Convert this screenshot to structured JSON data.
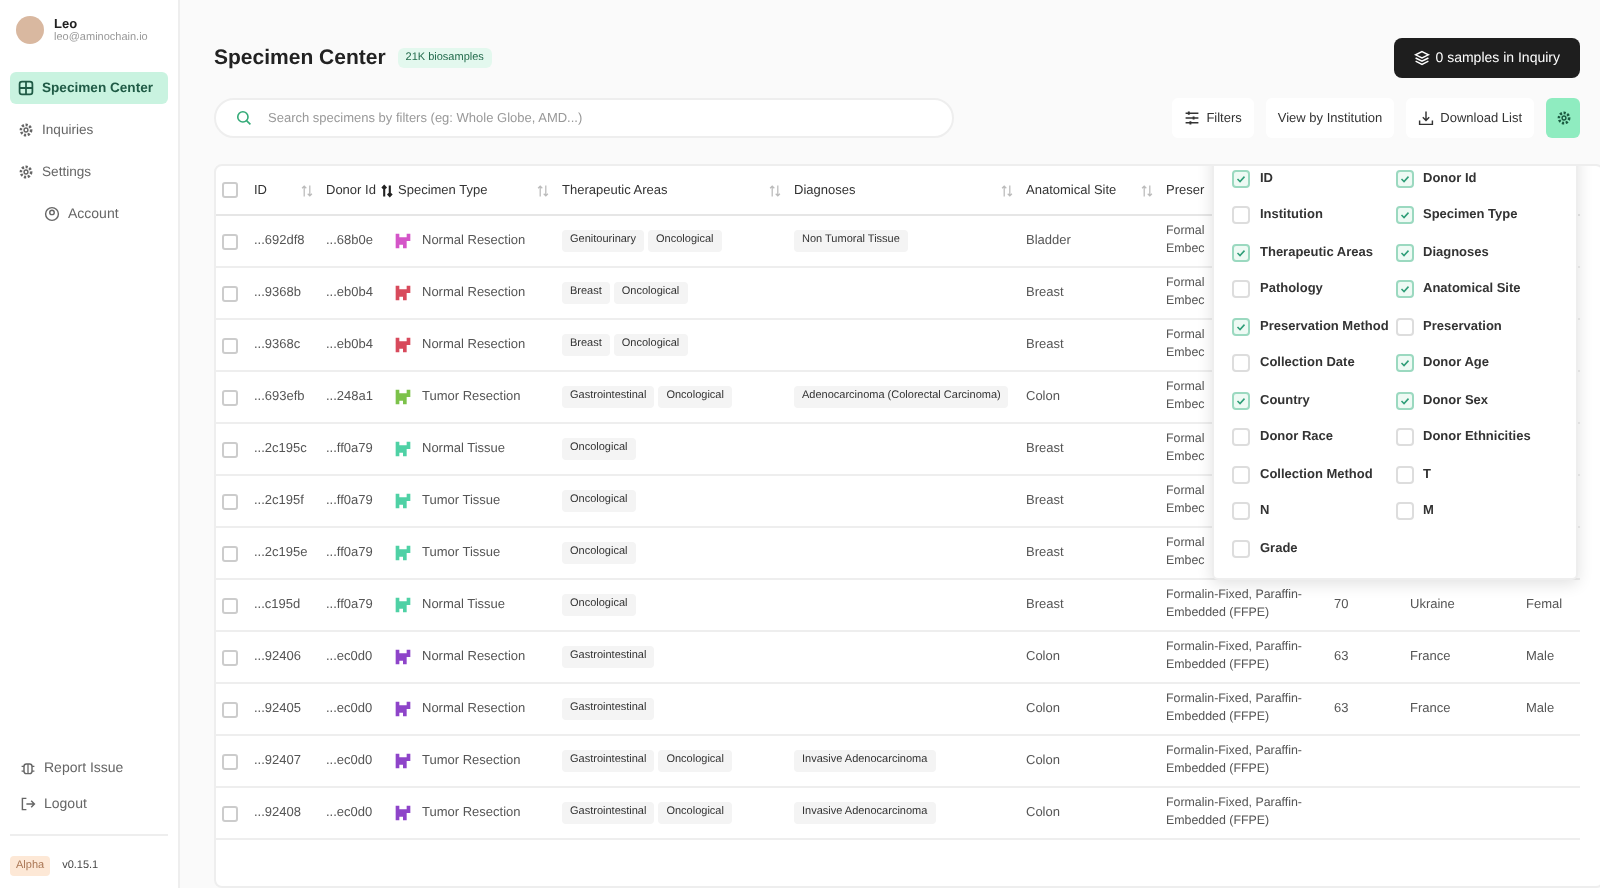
{
  "user": {
    "name": "Leo",
    "email": "leo@aminochain.io"
  },
  "nav": [
    {
      "label": "Specimen Center",
      "selected": true
    },
    {
      "label": "Inquiries",
      "selected": false
    },
    {
      "label": "Settings",
      "selected": false
    }
  ],
  "sub_nav": {
    "label": "Account"
  },
  "footer_nav": [
    {
      "label": "Report Issue"
    },
    {
      "label": "Logout"
    }
  ],
  "release": {
    "badge": "Alpha",
    "version": "v0.15.1"
  },
  "header": {
    "title": "Specimen Center",
    "count_badge": "21K biosamples",
    "inquiry_button": "0 samples in Inquiry"
  },
  "search": {
    "placeholder": "Search specimens by filters (eg: Whole Globe, AMD...)"
  },
  "toolbar": [
    {
      "label": "Filters"
    },
    {
      "label": "View by Institution"
    },
    {
      "label": "Download List"
    }
  ],
  "settings_button": {
    "active": true
  },
  "table": {
    "all_checked": false,
    "columns": [
      {
        "label": "ID",
        "sorted": false
      },
      {
        "label": "Donor Id",
        "sorted": true
      },
      {
        "label": "Specimen Type",
        "sorted": false
      },
      {
        "label": "Therapeutic Areas",
        "sorted": false
      },
      {
        "label": "Diagnoses",
        "sorted": false
      },
      {
        "label": "Anatomical Site",
        "sorted": false
      },
      {
        "label": "Preser"
      }
    ],
    "rows": [
      {
        "checked": false,
        "id": "...692df8",
        "donor": "...68b0e",
        "color": "#d455c8",
        "type": "Normal Resection",
        "areas": [
          "Genitourinary",
          "Oncological"
        ],
        "diagnoses": [
          "Non Tumoral Tissue"
        ],
        "site": "Bladder",
        "preservation": "Formal\nEmbec"
      },
      {
        "checked": false,
        "id": "...9368b",
        "donor": "...eb0b4",
        "color": "#d84a5c",
        "type": "Normal Resection",
        "areas": [
          "Breast",
          "Oncological"
        ],
        "diagnoses": [],
        "site": "Breast",
        "preservation": "Formal\nEmbec"
      },
      {
        "checked": false,
        "id": "...9368c",
        "donor": "...eb0b4",
        "color": "#d84a5c",
        "type": "Normal Resection",
        "areas": [
          "Breast",
          "Oncological"
        ],
        "diagnoses": [],
        "site": "Breast",
        "preservation": "Formal\nEmbec"
      },
      {
        "checked": false,
        "id": "...693efb",
        "donor": "...248a1",
        "color": "#7cc24a",
        "type": "Tumor Resection",
        "areas": [
          "Gastrointestinal",
          "Oncological"
        ],
        "diagnoses": [
          "Adenocarcinoma (Colorectal Carcinoma)"
        ],
        "site": "Colon",
        "preservation": "Formal\nEmbec"
      },
      {
        "checked": false,
        "id": "...2c195c",
        "donor": "...ff0a79",
        "color": "#4fd1a5",
        "type": "Normal Tissue",
        "areas": [
          "Oncological"
        ],
        "diagnoses": [],
        "site": "Breast",
        "preservation": "Formal\nEmbec"
      },
      {
        "checked": false,
        "id": "...2c195f",
        "donor": "...ff0a79",
        "color": "#4fd1a5",
        "type": "Tumor Tissue",
        "areas": [
          "Oncological"
        ],
        "diagnoses": [],
        "site": "Breast",
        "preservation": "Formal\nEmbec"
      },
      {
        "checked": false,
        "id": "...2c195e",
        "donor": "...ff0a79",
        "color": "#4fd1a5",
        "type": "Tumor Tissue",
        "areas": [
          "Oncological"
        ],
        "diagnoses": [],
        "site": "Breast",
        "preservation": "Formal\nEmbec"
      },
      {
        "checked": false,
        "id": "...c195d",
        "donor": "...ff0a79",
        "color": "#4fd1a5",
        "type": "Normal Tissue",
        "areas": [
          "Oncological"
        ],
        "diagnoses": [],
        "site": "Breast",
        "preservation": "Formalin-Fixed, Paraffin-\nEmbedded (FFPE)",
        "age": "70",
        "country": "Ukraine",
        "sex": "Femal"
      },
      {
        "checked": false,
        "id": "...92406",
        "donor": "...ec0d0",
        "color": "#8e44c9",
        "type": "Normal Resection",
        "areas": [
          "Gastrointestinal"
        ],
        "diagnoses": [],
        "site": "Colon",
        "preservation": "Formalin-Fixed, Paraffin-\nEmbedded (FFPE)",
        "age": "63",
        "country": "France",
        "sex": "Male"
      },
      {
        "checked": false,
        "id": "...92405",
        "donor": "...ec0d0",
        "color": "#8e44c9",
        "type": "Normal Resection",
        "areas": [
          "Gastrointestinal"
        ],
        "diagnoses": [],
        "site": "Colon",
        "preservation": "Formalin-Fixed, Paraffin-\nEmbedded (FFPE)",
        "age": "63",
        "country": "France",
        "sex": "Male"
      },
      {
        "checked": false,
        "id": "...92407",
        "donor": "...ec0d0",
        "color": "#8e44c9",
        "type": "Tumor Resection",
        "areas": [
          "Gastrointestinal",
          "Oncological"
        ],
        "diagnoses": [
          "Invasive Adenocarcinoma"
        ],
        "site": "Colon",
        "preservation": "Formalin-Fixed, Paraffin-\nEmbedded (FFPE)"
      },
      {
        "checked": false,
        "id": "...92408",
        "donor": "...ec0d0",
        "color": "#8e44c9",
        "type": "Tumor Resection",
        "areas": [
          "Gastrointestinal",
          "Oncological"
        ],
        "diagnoses": [
          "Invasive Adenocarcinoma"
        ],
        "site": "Colon",
        "preservation": "Formalin-Fixed, Paraffin-\nEmbedded (FFPE)"
      }
    ]
  },
  "column_menu": [
    {
      "label": "ID",
      "checked": true
    },
    {
      "label": "Donor Id",
      "checked": true
    },
    {
      "label": "Institution",
      "checked": false
    },
    {
      "label": "Specimen Type",
      "checked": true
    },
    {
      "label": "Therapeutic Areas",
      "checked": true
    },
    {
      "label": "Diagnoses",
      "checked": true
    },
    {
      "label": "Pathology",
      "checked": false
    },
    {
      "label": "Anatomical Site",
      "checked": true
    },
    {
      "label": "Preservation Method",
      "checked": true
    },
    {
      "label": "Preservation",
      "checked": false
    },
    {
      "label": "Collection Date",
      "checked": false
    },
    {
      "label": "Donor Age",
      "checked": true
    },
    {
      "label": "Country",
      "checked": true
    },
    {
      "label": "Donor Sex",
      "checked": true
    },
    {
      "label": "Donor Race",
      "checked": false
    },
    {
      "label": "Donor Ethnicities",
      "checked": false
    },
    {
      "label": "Collection Method",
      "checked": false
    },
    {
      "label": "T",
      "checked": false
    },
    {
      "label": "N",
      "checked": false
    },
    {
      "label": "M",
      "checked": false
    },
    {
      "label": "Grade",
      "checked": false
    }
  ]
}
